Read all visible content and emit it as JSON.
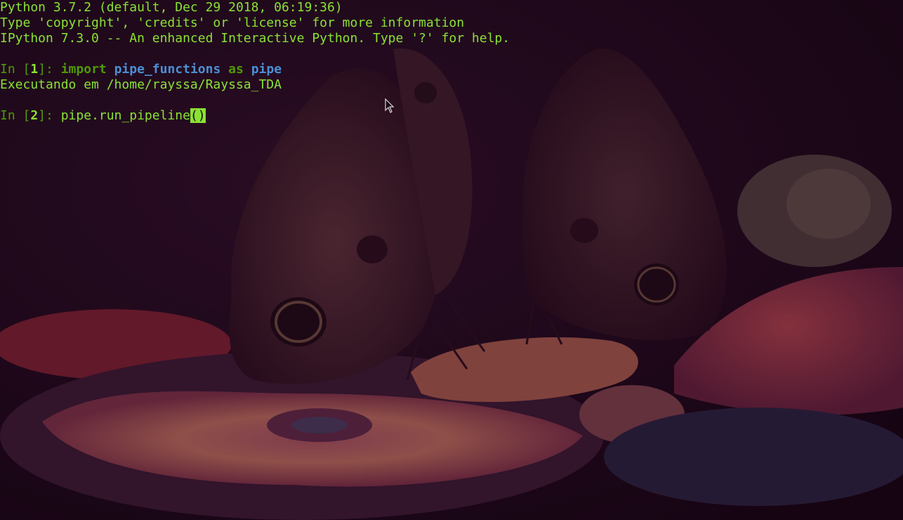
{
  "banner": {
    "line1": "Python 3.7.2 (default, Dec 29 2018, 06:19:36)",
    "line2": "Type 'copyright', 'credits' or 'license' for more information",
    "line3": "IPython 7.3.0 -- An enhanced Interactive Python. Type '?' for help."
  },
  "cells": [
    {
      "prompt_in": "In [",
      "number": "1",
      "prompt_close": "]: ",
      "tokens": {
        "import_kw": "import",
        "module": "pipe_functions",
        "as_kw": "as",
        "alias": "pipe"
      },
      "output": "Executando em /home/rayssa/Rayssa_TDA"
    },
    {
      "prompt_in": "In [",
      "number": "2",
      "prompt_close": "]: ",
      "code": "pipe.run_pipeline",
      "open_paren": "(",
      "close_paren": ")"
    }
  ],
  "colors": {
    "text_green": "#8ae234",
    "prompt_green": "#4e9a06",
    "module_blue": "#4b8fd6",
    "background": "#1a0716"
  },
  "icons": {
    "mouse_pointer": "arrow-cursor-icon"
  }
}
